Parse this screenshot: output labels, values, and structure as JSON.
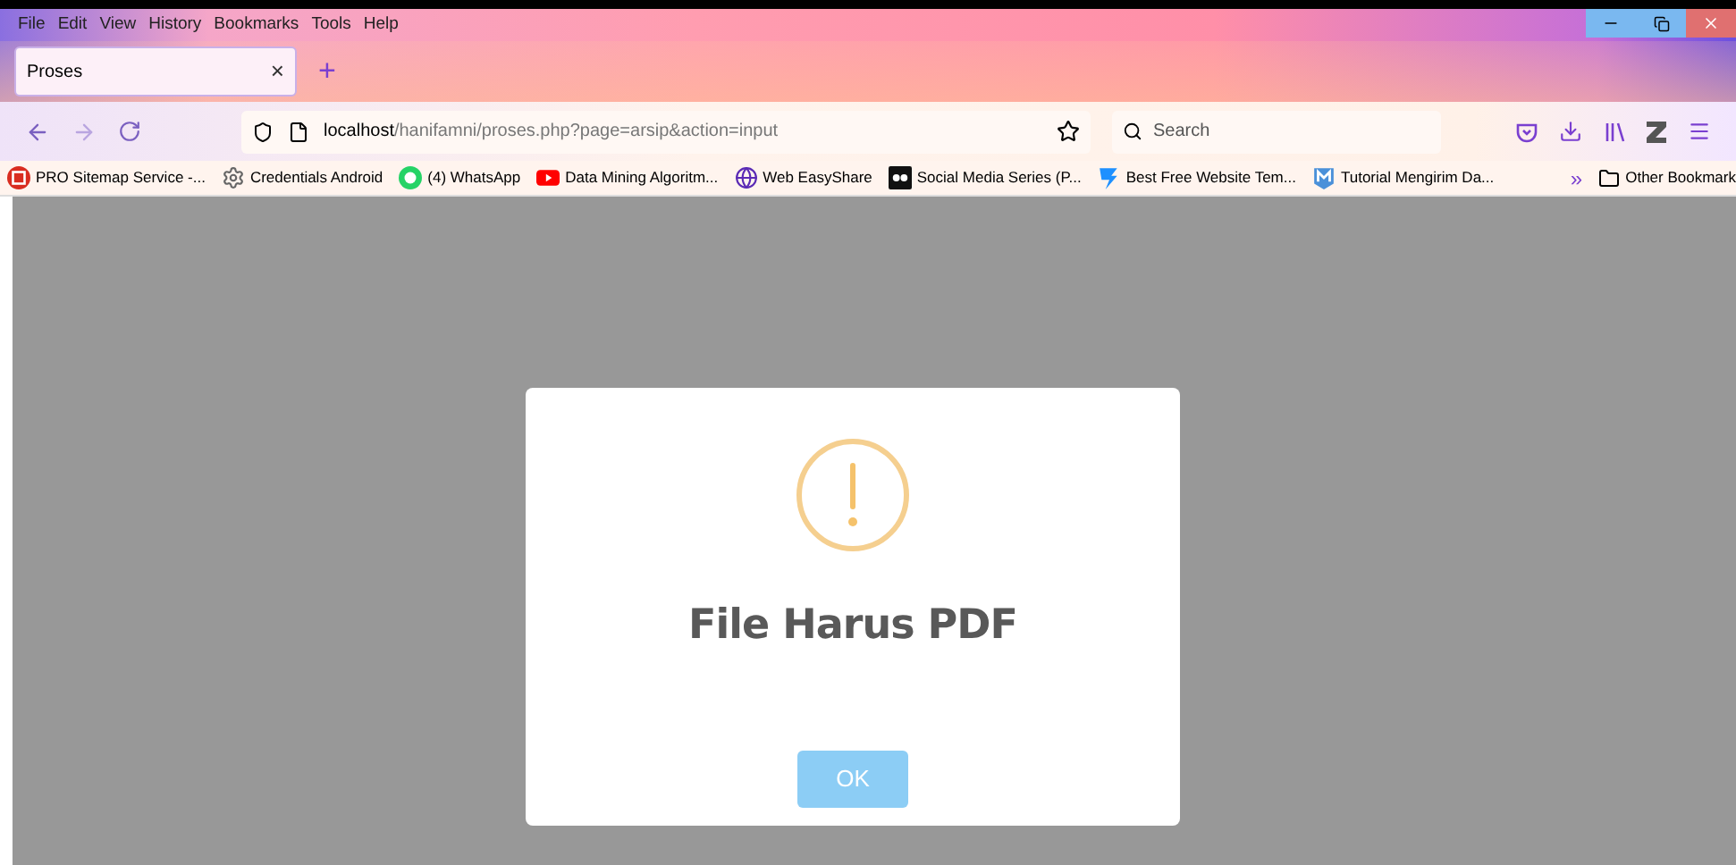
{
  "menu": [
    "File",
    "Edit",
    "View",
    "History",
    "Bookmarks",
    "Tools",
    "Help"
  ],
  "tabs": [
    {
      "label": "Proses",
      "selected": true,
      "close": "×"
    }
  ],
  "new_tab": "+",
  "address": {
    "host": "localhost",
    "path": "/hanifamni/proses.php?page=arsip&action=input"
  },
  "search": {
    "placeholder": "Search"
  },
  "bookmarks": [
    {
      "label": "PRO Sitemap Service -...",
      "kind": "red"
    },
    {
      "label": "Credentials Android",
      "kind": "gear"
    },
    {
      "label": "(4) WhatsApp",
      "kind": "whatsapp"
    },
    {
      "label": "Data Mining Algoritm...",
      "kind": "youtube"
    },
    {
      "label": "Web EasyShare",
      "kind": "globe"
    },
    {
      "label": "Social Media Series (P...",
      "kind": "dark"
    },
    {
      "label": "Best Free Website Tem...",
      "kind": "blue"
    },
    {
      "label": "Tutorial Mengirim Da...",
      "kind": "m"
    }
  ],
  "more": "»",
  "other_bookmarks": "Other Bookmark",
  "dialog": {
    "title": "File Harus PDF",
    "button": "OK"
  }
}
